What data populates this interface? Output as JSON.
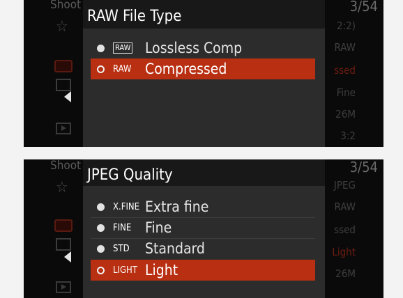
{
  "background_menu": {
    "tab_title": "Shoot",
    "page_indicator": "3/54",
    "top_values": [
      "2:2)",
      "RAW",
      "ssed",
      "Fine",
      "26M",
      "3:2"
    ],
    "bottom_values": [
      "JPEG",
      "RAW",
      "ssed",
      "Light",
      "26M"
    ]
  },
  "raw_dialog": {
    "title": "RAW File Type",
    "options": [
      {
        "badge": "RAW",
        "label": "Lossless Comp",
        "selected": false
      },
      {
        "badge": "RAW",
        "label": "Compressed",
        "selected": true
      }
    ]
  },
  "jpeg_dialog": {
    "title": "JPEG Quality",
    "options": [
      {
        "badge": "X.FINE",
        "label": "Extra fine",
        "selected": false
      },
      {
        "badge": "FINE",
        "label": "Fine",
        "selected": false
      },
      {
        "badge": "STD",
        "label": "Standard",
        "selected": false
      },
      {
        "badge": "LIGHT",
        "label": "Light",
        "selected": true
      }
    ]
  },
  "colors": {
    "highlight": "#b82f11",
    "dialog_bg": "#2c2c2c",
    "header_bg": "#181818"
  }
}
